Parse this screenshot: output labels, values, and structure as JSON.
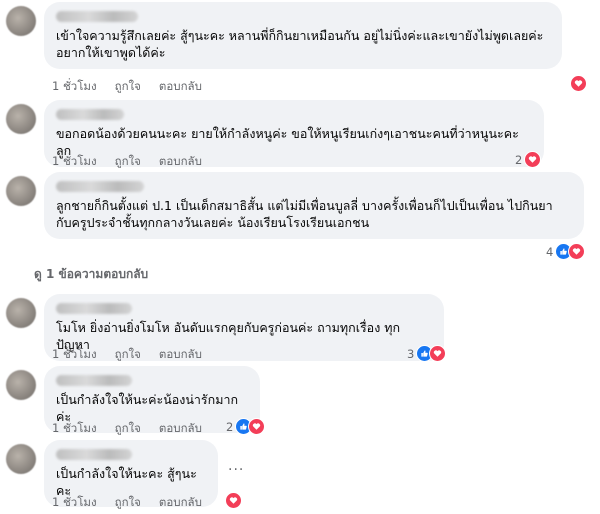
{
  "comments": [
    {
      "text_lines": [
        "เข้าใจความรู้สึกเลยค่ะ สู้ๆนะคะ หลานพี่ก็กินยาเหมือนกัน อยู่ไม่นิ่งค่ะและเขายังไม่พูดเลยค่ะ",
        "อยากให้เขาพูดได้ค่ะ"
      ],
      "time": "1 ชั่วโมง",
      "like": "ถูกใจ",
      "reply": "ตอบกลับ",
      "reaction_count": "",
      "reactions": [
        "love"
      ]
    },
    {
      "text_lines": [
        "ขอกอดน้องด้วยคนนะคะ ยายให้กำลังหนูค่ะ ขอให้หนูเรียนเก่งๆเอาชนะคนที่ว่าหนูนะคะลูก"
      ],
      "time": "1 ชั่วโมง",
      "like": "ถูกใจ",
      "reply": "ตอบกลับ",
      "reaction_count": "2",
      "reactions": [
        "love"
      ]
    },
    {
      "text_lines": [
        "ลูกชายก็กินตั้งแต่ ป.1 เป็นเด็กสมาธิสั้น แต่ไม่มีเพื่อนบูลลี่ บางครั้งเพื่อนก็ไปเป็นเพื่อน ไปกินยา",
        "กับครูประจำชั้นทุกกลางวันเลยค่ะ น้องเรียนโรงเรียนเอกชน"
      ],
      "time": "",
      "like": "",
      "reply": "",
      "reaction_count": "4",
      "reactions": [
        "like",
        "love"
      ]
    },
    {
      "text_lines": [
        "โมโห ยิ่งอ่านยิ่งโมโห อันดับแรกคุยกับครูก่อนค่ะ ถามทุกเรื่อง ทุกปัญหา"
      ],
      "time": "1 ชั่วโมง",
      "like": "ถูกใจ",
      "reply": "ตอบกลับ",
      "reaction_count": "3",
      "reactions": [
        "like",
        "love"
      ]
    },
    {
      "text_lines": [
        "เป็นกำลังใจให้นะค่ะน้องน่ารักมากค่ะ"
      ],
      "time": "1 ชั่วโมง",
      "like": "ถูกใจ",
      "reply": "ตอบกลับ",
      "reaction_count": "2",
      "reactions": [
        "like",
        "love"
      ]
    },
    {
      "text_lines": [
        "เป็นกำลังใจให้นะคะ สู้ๆนะคะ"
      ],
      "time": "1 ชั่วโมง",
      "like": "ถูกใจ",
      "reply": "ตอบกลับ",
      "reaction_count": "",
      "reactions": [
        "love"
      ]
    }
  ],
  "view_replies": "ดู 1 ข้อความตอบกลับ",
  "more_dots": "...",
  "colors": {
    "bubble": "#f0f2f5",
    "like_blue": "#1877f2",
    "love_red": "#f33e58",
    "meta_gray": "#65676b"
  }
}
